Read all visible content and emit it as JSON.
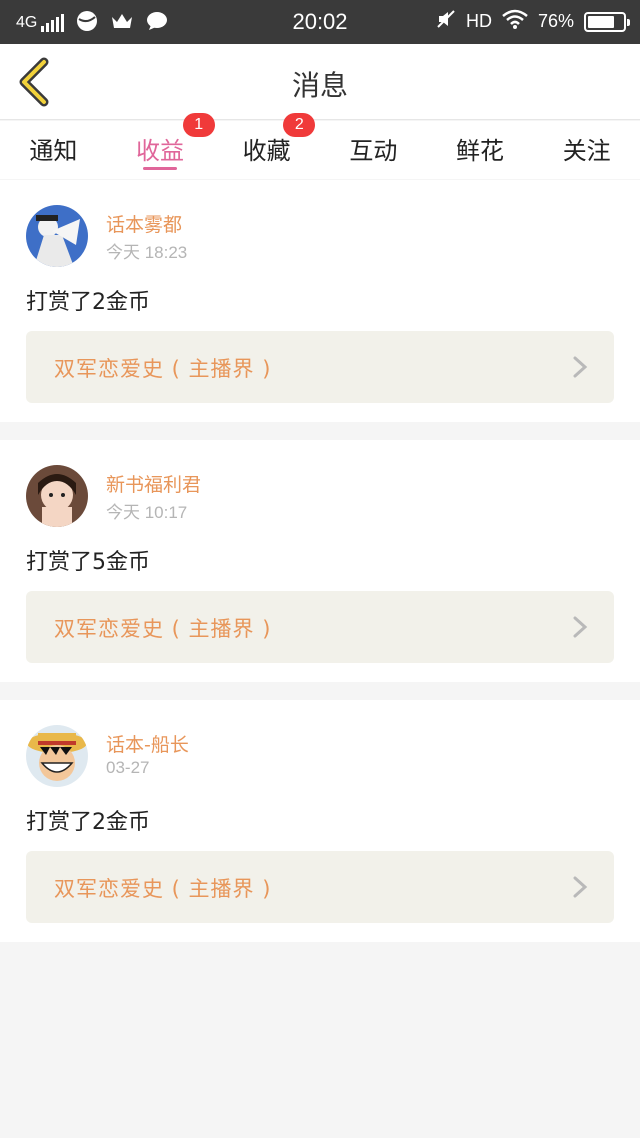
{
  "status_bar": {
    "network": "4G",
    "time": "20:02",
    "hd": "HD",
    "battery": "76%",
    "battery_level": 0.76
  },
  "header": {
    "title": "消息"
  },
  "tabs": [
    {
      "label": "通知",
      "badge": ""
    },
    {
      "label": "收益",
      "badge": "1"
    },
    {
      "label": "收藏",
      "badge": "2"
    },
    {
      "label": "互动",
      "badge": ""
    },
    {
      "label": "鲜花",
      "badge": ""
    },
    {
      "label": "关注",
      "badge": ""
    }
  ],
  "active_tab": 1,
  "messages": [
    {
      "user": "话本雾都",
      "time": "今天 18:23",
      "text": "打赏了2金币",
      "link": "双军恋爱史 ( 主播界 )"
    },
    {
      "user": "新书福利君",
      "time": "今天 10:17",
      "text": "打赏了5金币",
      "link": "双军恋爱史 ( 主播界 )"
    },
    {
      "user": "话本-船长",
      "time": "03-27",
      "text": "打赏了2金币",
      "link": "双军恋爱史 ( 主播界 )"
    }
  ],
  "colors": {
    "accent": "#e0669a",
    "name": "#e8965a",
    "badge": "#f03a3a",
    "link_bg": "#f2f1ea"
  }
}
